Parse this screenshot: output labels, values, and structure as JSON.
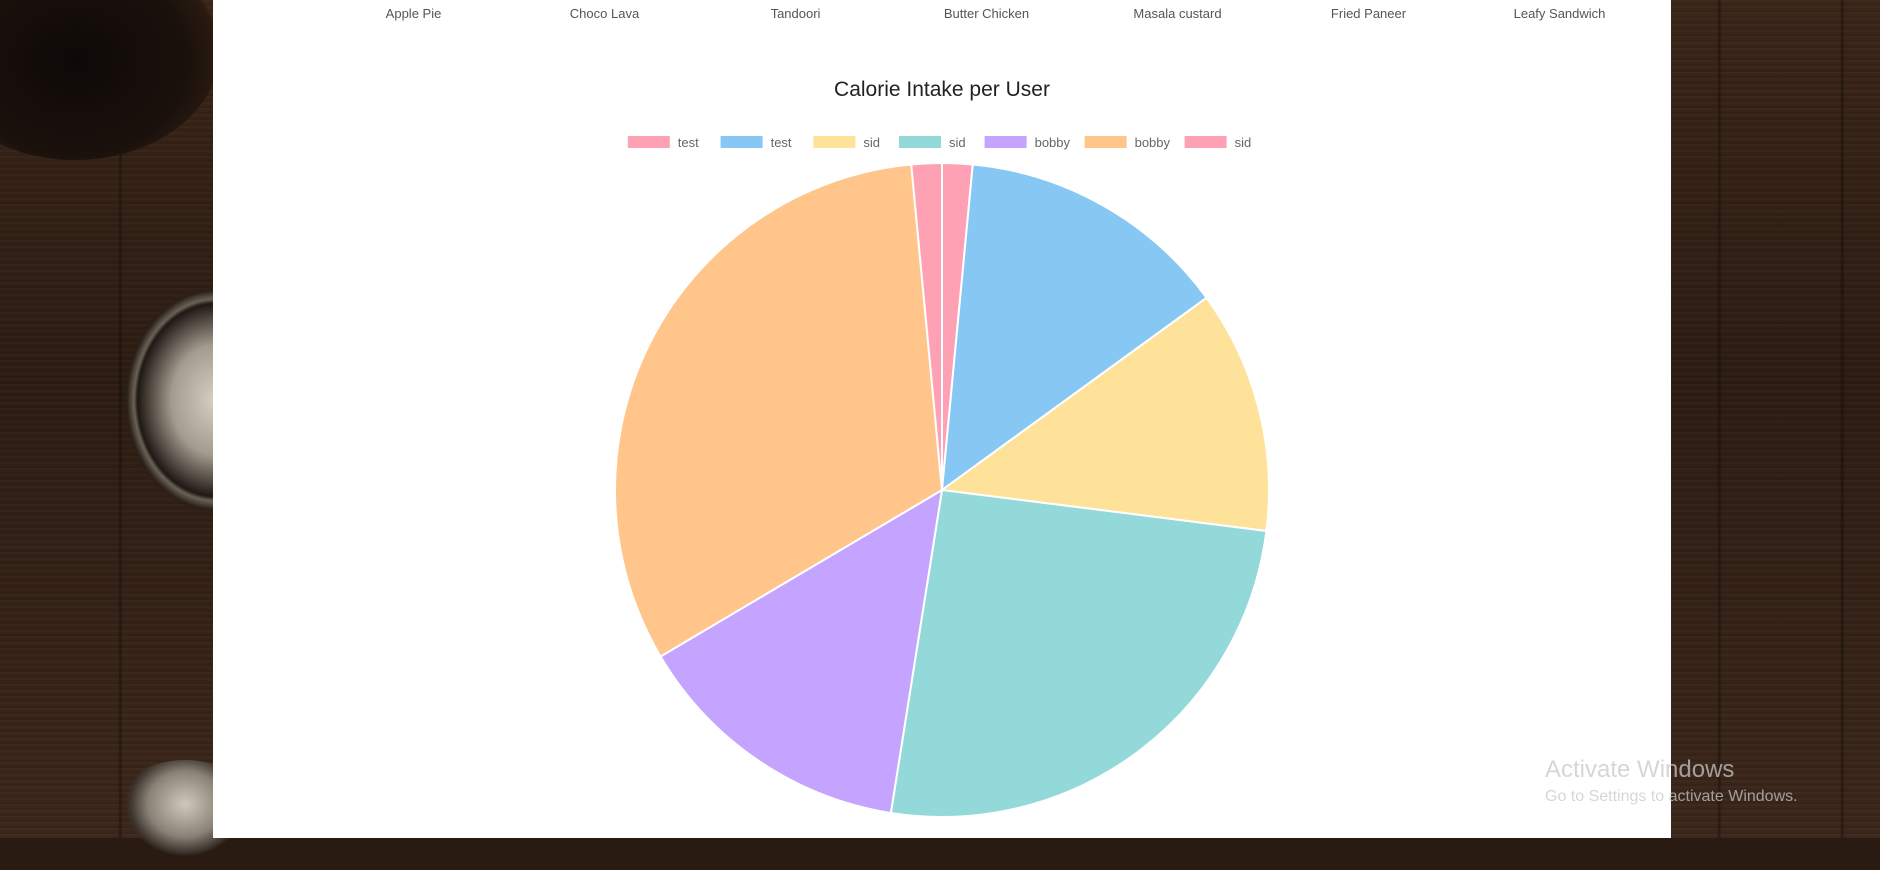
{
  "menu": {
    "items": [
      "Apple Pie",
      "Choco Lava",
      "Tandoori",
      "Butter Chicken",
      "Masala custard",
      "Fried Paneer",
      "Leafy Sandwich"
    ]
  },
  "chart_data": {
    "type": "pie",
    "title": "Calorie Intake per User",
    "legend_position": "top",
    "labels": [
      "test",
      "test",
      "sid",
      "sid",
      "bobby",
      "bobby",
      "sid"
    ],
    "values": [
      1.5,
      13.5,
      12.0,
      25.5,
      14.0,
      32.0,
      1.5
    ],
    "colors": [
      "#ffa1b5",
      "#86c7f3",
      "#ffe29a",
      "#93d9d9",
      "#c4a4ff",
      "#ffc58a",
      "#ffa1b5"
    ],
    "start_angle_deg": -90
  },
  "watermark": {
    "title": "Activate Windows",
    "subtitle": "Go to Settings to activate Windows."
  }
}
